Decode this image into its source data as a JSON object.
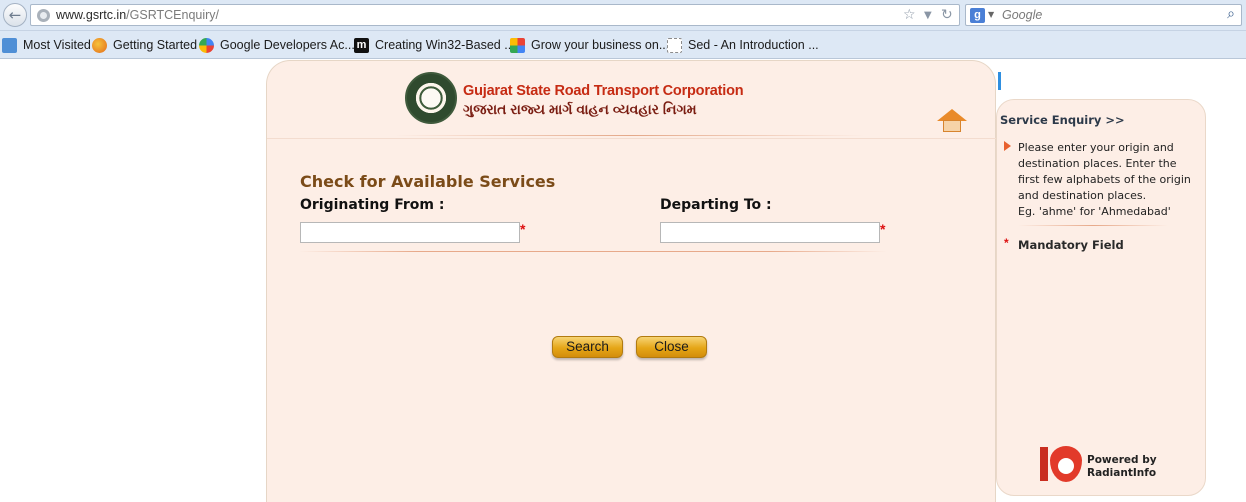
{
  "browser": {
    "url_host": "www.gsrtc.in",
    "url_path": "/GSRTCEnquiry/",
    "search_placeholder": "Google",
    "bookmarks": [
      {
        "label": "Most Visited",
        "icon": "most-visited-icon"
      },
      {
        "label": "Getting Started",
        "icon": "firefox-icon"
      },
      {
        "label": "Google Developers Ac...",
        "icon": "google-developers-icon"
      },
      {
        "label": "Creating Win32-Based ...",
        "icon": "msdn-icon"
      },
      {
        "label": "Grow your business on...",
        "icon": "google-business-icon"
      },
      {
        "label": "Sed - An Introduction ...",
        "icon": "blank-page-icon"
      }
    ]
  },
  "header": {
    "org_name": "Gujarat State Road Transport Corporation",
    "org_name_gujarati": "ગુજરાત રાજ્ય માર્ગ વાહન વ્યવહાર નિગમ"
  },
  "form": {
    "title": "Check for Available Services",
    "origin_label": "Originating From :",
    "origin_value": "",
    "destination_label": "Departing To :",
    "destination_value": "",
    "required_mark": "*",
    "search_button": "Search",
    "close_button": "Close"
  },
  "side": {
    "title": "Service Enquiry >>",
    "help_text": "Please enter your origin and destination places. Enter the first few alphabets of the origin and destination places.",
    "example_text": "Eg. 'ahme' for 'Ahmedabad'",
    "mandatory_mark": "*",
    "mandatory_label": "Mandatory Field"
  },
  "footer": {
    "powered_line1": "Powered by",
    "powered_line2": "RadiantInfo"
  },
  "colors": {
    "panel_bg": "#fdeee6",
    "org_red": "#c62b13",
    "title_brown": "#7b4b18",
    "button_gold": "#e5a617"
  }
}
